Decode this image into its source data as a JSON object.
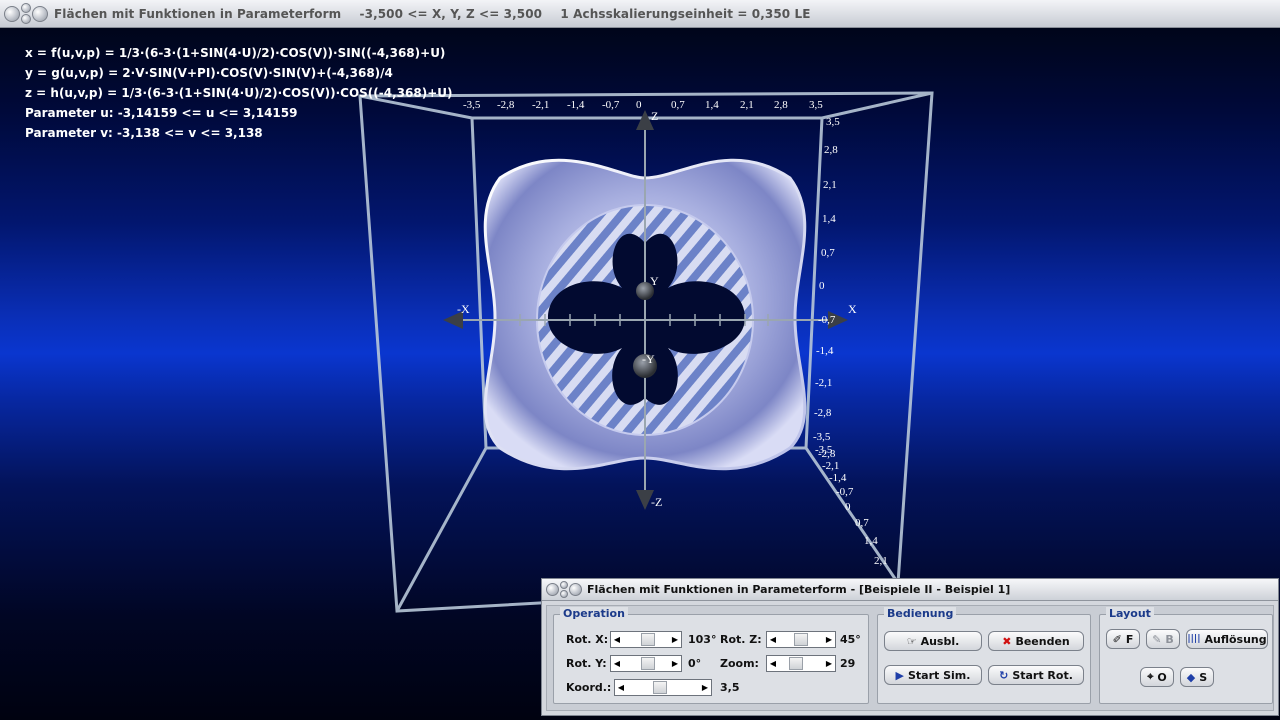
{
  "window": {
    "title": "Flächen mit Funktionen in Parameterform",
    "range": "-3,500 <= X, Y, Z <= 3,500",
    "scale": "1 Achsskalierungseinheit = 0,350 LE"
  },
  "formulas": {
    "x": "x = f(u,v,p) = 1/3·(6-3·(1+SIN(4·U)/2)·COS(V))·SIN((-4,368)+U)",
    "y": "y = g(u,v,p) = 2·V·SIN(V+PI)·COS(V)·SIN(V)+(-4,368)/4",
    "z": "z = h(u,v,p) = 1/3·(6-3·(1+SIN(4·U)/2)·COS(V))·COS((-4,368)+U)",
    "param_u": "Parameter u: -3,14159 <= u <= 3,14159",
    "param_v": "Parameter v: -3,138 <= v <= 3,138"
  },
  "axes": {
    "x_label": "X",
    "neg_x_label": "-X",
    "y_label": "Y",
    "neg_y_label": "-Y",
    "z_label": "Z",
    "neg_z_label": "-Z",
    "top_ticks": [
      "-3,5",
      "-2,8",
      "-2,1",
      "-1,4",
      "-0,7",
      "0",
      "0,7",
      "1,4",
      "2,1",
      "2,8",
      "3,5"
    ],
    "right_ticks": [
      "3,5",
      "2,8",
      "2,1",
      "1,4",
      "0,7",
      "0",
      "-0,7",
      "-1,4",
      "-2,1",
      "-2,8",
      "-3,5"
    ],
    "depth_ticks": [
      "-3,5",
      "-2,8",
      "-2,1",
      "-1,4",
      "-0,7",
      "0",
      "0,7",
      "1,4",
      "2,1"
    ]
  },
  "panel": {
    "title": "Flächen mit Funktionen in Parameterform - [Beispiele II - Beispiel 1]",
    "operation": {
      "label": "Operation",
      "rot_x_label": "Rot. X:",
      "rot_x_value": "103°",
      "rot_y_label": "Rot. Y:",
      "rot_y_value": "0°",
      "rot_z_label": "Rot. Z:",
      "rot_z_value": "45°",
      "zoom_label": "Zoom:",
      "zoom_value": "29",
      "koord_label": "Koord.:",
      "koord_value": "3,5"
    },
    "bedienung": {
      "label": "Bedienung",
      "ausbl": "Ausbl.",
      "beenden": "Beenden",
      "start_sim": "Start Sim.",
      "start_rot": "Start Rot."
    },
    "layout": {
      "label": "Layout",
      "f": "F",
      "b": "B",
      "aufloesung": "Auflösung",
      "o": "O",
      "s": "S"
    }
  },
  "colors": {
    "accent": "#1b3a8a",
    "close_red": "#d01010",
    "play_blue": "#1f3fa8"
  }
}
